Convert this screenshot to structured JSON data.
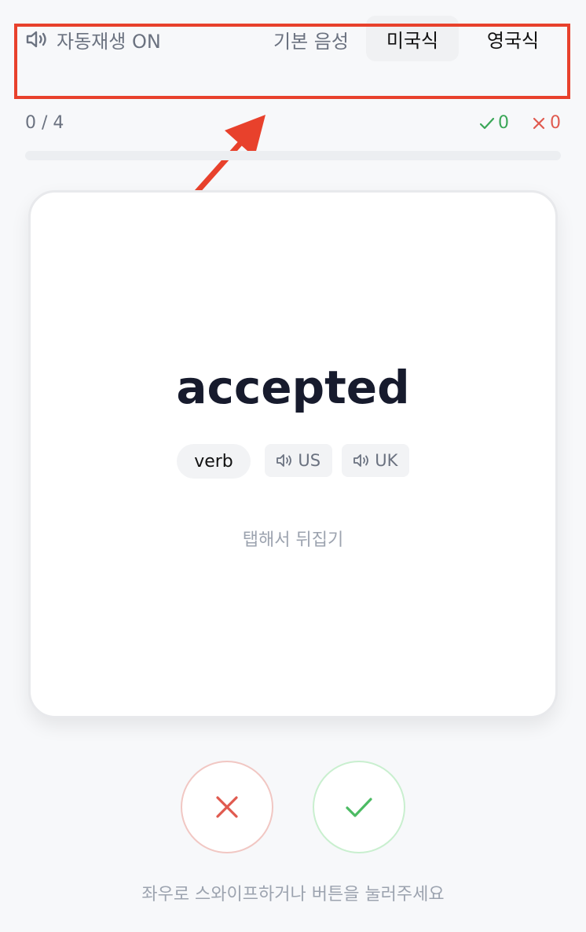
{
  "header": {
    "autoplay_label": "자동재생 ON",
    "voice_label": "기본 음성",
    "voice_options": [
      "미국식",
      "영국식"
    ],
    "selected_voice": "미국식"
  },
  "progress": {
    "count_text": "0 / 4",
    "correct_count": "0",
    "wrong_count": "0",
    "fraction": 0
  },
  "card": {
    "word": "accepted",
    "part_of_speech": "verb",
    "audio_us_label": "US",
    "audio_uk_label": "UK",
    "flip_hint": "탭해서 뒤집기"
  },
  "footer": {
    "hint": "좌우로 스와이프하거나 버튼을 눌러주세요"
  },
  "colors": {
    "accent_green": "#3aa657",
    "accent_red": "#e05a4f",
    "annotation_red": "#e8412c"
  },
  "icons": {
    "autoplay": "speaker-icon",
    "correct": "check-icon",
    "wrong": "x-icon"
  }
}
